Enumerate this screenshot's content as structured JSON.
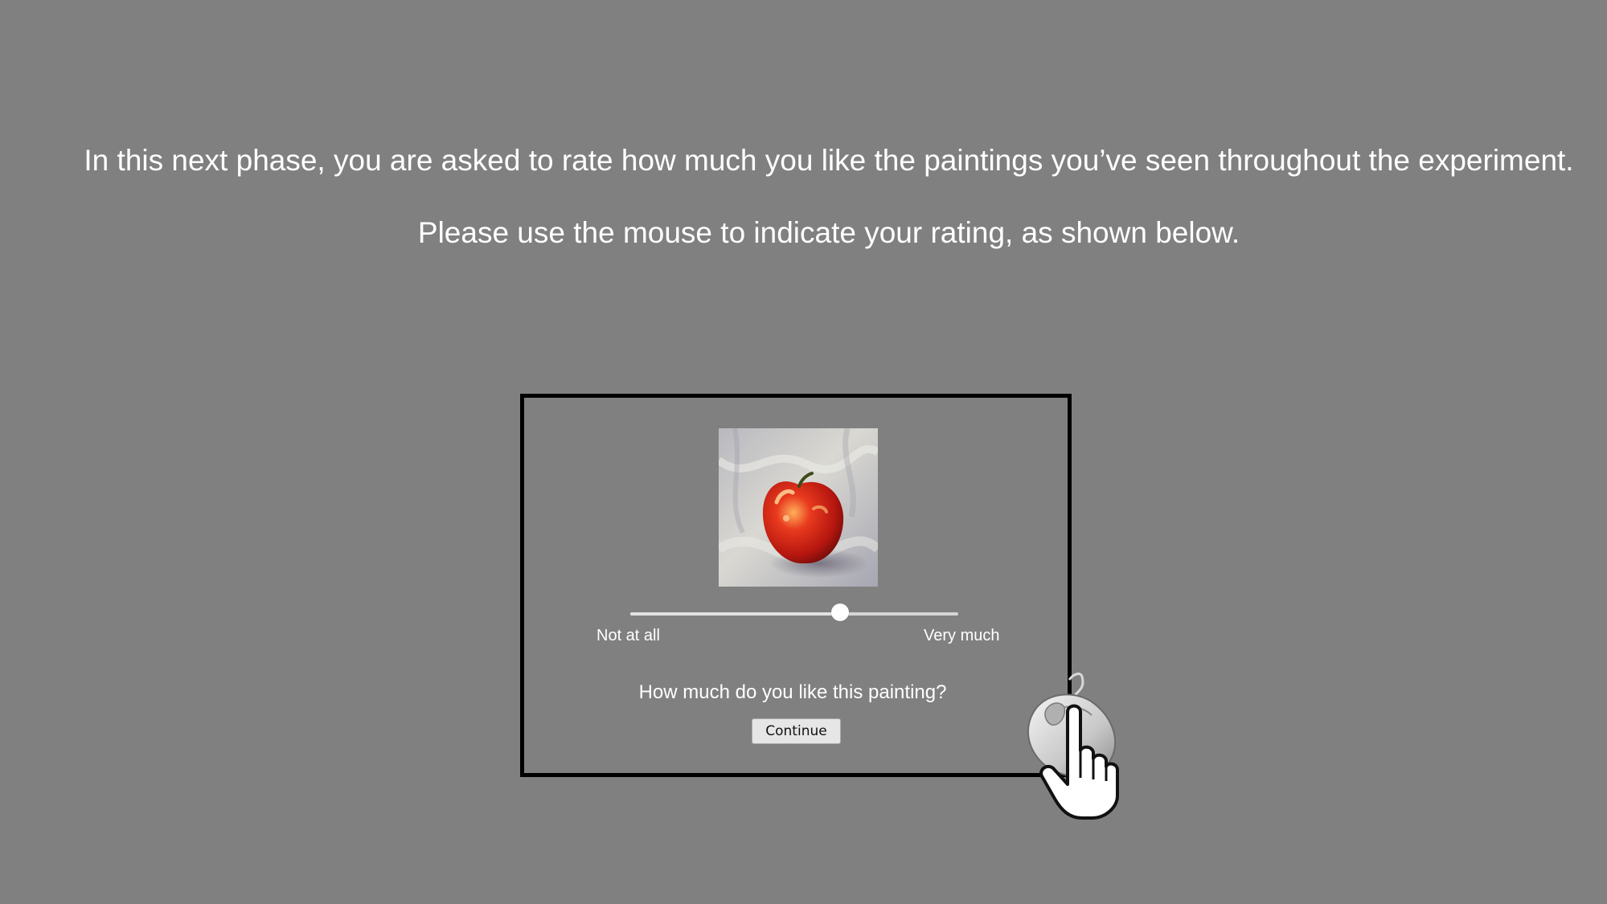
{
  "instructions": {
    "line1": "In this next phase, you are asked to rate how much you like the paintings you’ve seen throughout the experiment.",
    "line2": "Please use the mouse to indicate your rating, as shown below."
  },
  "demo": {
    "painting": {
      "subject": "apple-painting"
    },
    "slider": {
      "value": 0.64,
      "min_label": "Not at all",
      "max_label": "Very much"
    },
    "question": "How much do you like this painting?",
    "continue_label": "Continue"
  },
  "colors": {
    "background": "#808080",
    "text": "#ffffff",
    "frame": "#000000",
    "button": "#e6e6e6"
  },
  "icons": {
    "mouse": "computer-mouse-icon",
    "hand": "pointing-hand-icon"
  }
}
